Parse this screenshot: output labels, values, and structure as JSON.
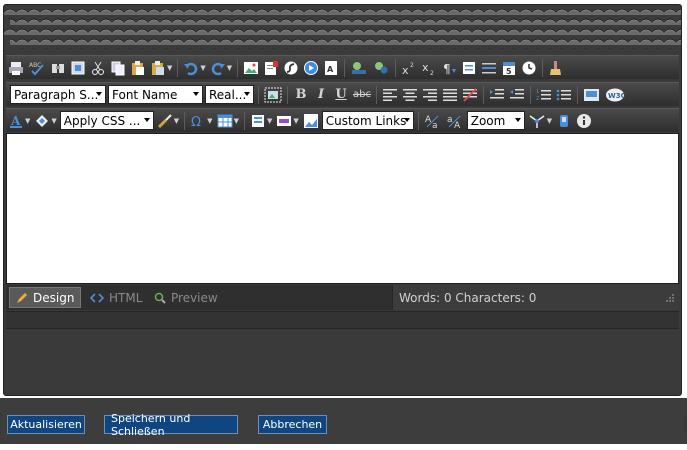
{
  "toolbar_row2": {
    "paragraph_style": "Paragraph S...",
    "font_name": "Font Name",
    "font_size": "Real...",
    "bold": "B",
    "italic": "I",
    "underline": "U",
    "strike": "abc"
  },
  "toolbar_row3": {
    "apply_css": "Apply CSS ...",
    "custom_links": "Custom Links",
    "zoom": "Zoom"
  },
  "mode_bar": {
    "design": "Design",
    "html": "HTML",
    "preview": "Preview",
    "stats": "Words: 0 Characters: 0"
  },
  "footer": {
    "update_button": "Aktualisieren",
    "save_close_button": "Speichern und Schließen",
    "cancel_button": "Abbrechen"
  },
  "colors": {
    "chrome": "#3a3a3a",
    "button_blue": "#0f4580",
    "icon_blue": "#4a8fd8"
  }
}
